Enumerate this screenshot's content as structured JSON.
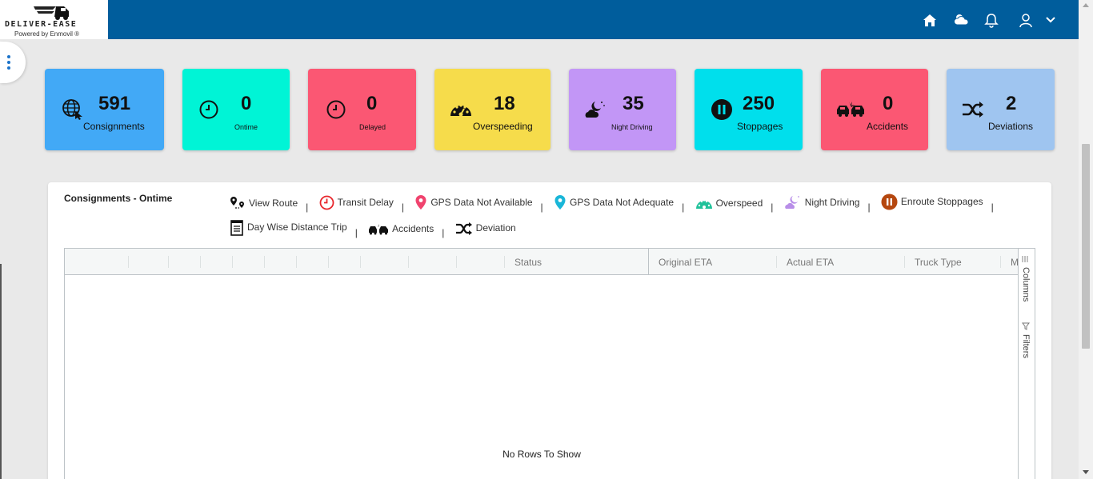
{
  "brand": {
    "name": "DELIVER-EASE",
    "powered_by": "Powered by Enmovil ®"
  },
  "header_icons": [
    "home-icon",
    "weather-icon",
    "bell-icon",
    "user-icon",
    "chevron-down-icon"
  ],
  "cards": [
    {
      "value": "591",
      "label": "Consignments",
      "color": "#42a9f6",
      "icon": "globe-click-icon"
    },
    {
      "value": "0",
      "label": "Ontime",
      "color": "#00f4d6",
      "icon": "clock-icon"
    },
    {
      "value": "0",
      "label": "Delayed",
      "color": "#fb5773",
      "icon": "clock-icon"
    },
    {
      "value": "18",
      "label": "Overspeeding",
      "color": "#f6dc4b",
      "icon": "speedometer-icon"
    },
    {
      "value": "35",
      "label": "Night Driving",
      "color": "#c296f6",
      "icon": "night-icon"
    },
    {
      "value": "250",
      "label": "Stoppages",
      "color": "#00dfec",
      "icon": "pause-icon"
    },
    {
      "value": "0",
      "label": "Accidents",
      "color": "#fb5773",
      "icon": "accident-icon"
    },
    {
      "value": "2",
      "label": "Deviations",
      "color": "#9fc5f0",
      "icon": "shuffle-icon"
    }
  ],
  "panel": {
    "title": "Consignments - Ontime",
    "legend": [
      {
        "label": "View Route",
        "icon": "route-icon"
      },
      {
        "label": "Transit Delay",
        "icon": "transit-delay-icon",
        "color": "#e8262c"
      },
      {
        "label": "GPS Data Not Available",
        "icon": "map-pin-icon",
        "color": "#f0436e"
      },
      {
        "label": "GPS Data Not Adequate",
        "icon": "map-pin-icon",
        "color": "#19b6d8"
      },
      {
        "label": "Overspeed",
        "icon": "speedometer-icon",
        "color": "#20c29a"
      },
      {
        "label": "Night Driving",
        "icon": "night-icon",
        "color": "#b88ee8"
      },
      {
        "label": "Enroute Stoppages",
        "icon": "pause-icon",
        "color": "#b5470f"
      },
      {
        "label": "Day Wise Distance Trip",
        "icon": "document-icon"
      },
      {
        "label": "Accidents",
        "icon": "accident-icon"
      },
      {
        "label": "Deviation",
        "icon": "shuffle-icon"
      }
    ]
  },
  "grid": {
    "columns": [
      "Status",
      "Original ETA",
      "Actual ETA",
      "Truck Type",
      "M"
    ],
    "empty_message": "No Rows To Show",
    "side_panel": [
      "Columns",
      "Filters"
    ]
  }
}
